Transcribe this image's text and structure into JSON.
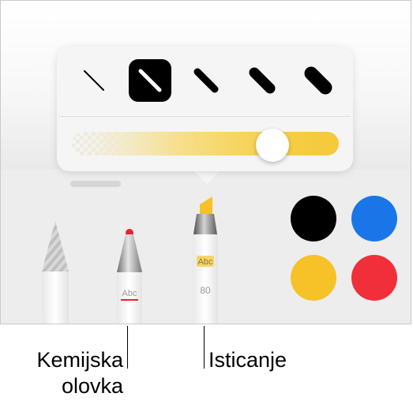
{
  "thickness_options": [
    {
      "name": "thickness-1",
      "selected": false
    },
    {
      "name": "thickness-2",
      "selected": true
    },
    {
      "name": "thickness-3",
      "selected": false
    },
    {
      "name": "thickness-4",
      "selected": false
    },
    {
      "name": "thickness-5",
      "selected": false
    }
  ],
  "opacity_slider": {
    "value": 0.74
  },
  "tools": {
    "pen": {
      "icon": "pen-icon"
    },
    "ballpoint": {
      "icon": "ballpoint-pen-icon",
      "label_text": "Abc"
    },
    "highlighter": {
      "icon": "highlighter-icon",
      "label_text": "Abc",
      "opacity_value": "80"
    }
  },
  "colors": [
    "#000000",
    "#1a76e8",
    "#f6c227",
    "#f02f3a"
  ],
  "callouts": {
    "ballpoint_line1": "Kemijska",
    "ballpoint_line2": "olovka",
    "highlighter": "Isticanje"
  }
}
